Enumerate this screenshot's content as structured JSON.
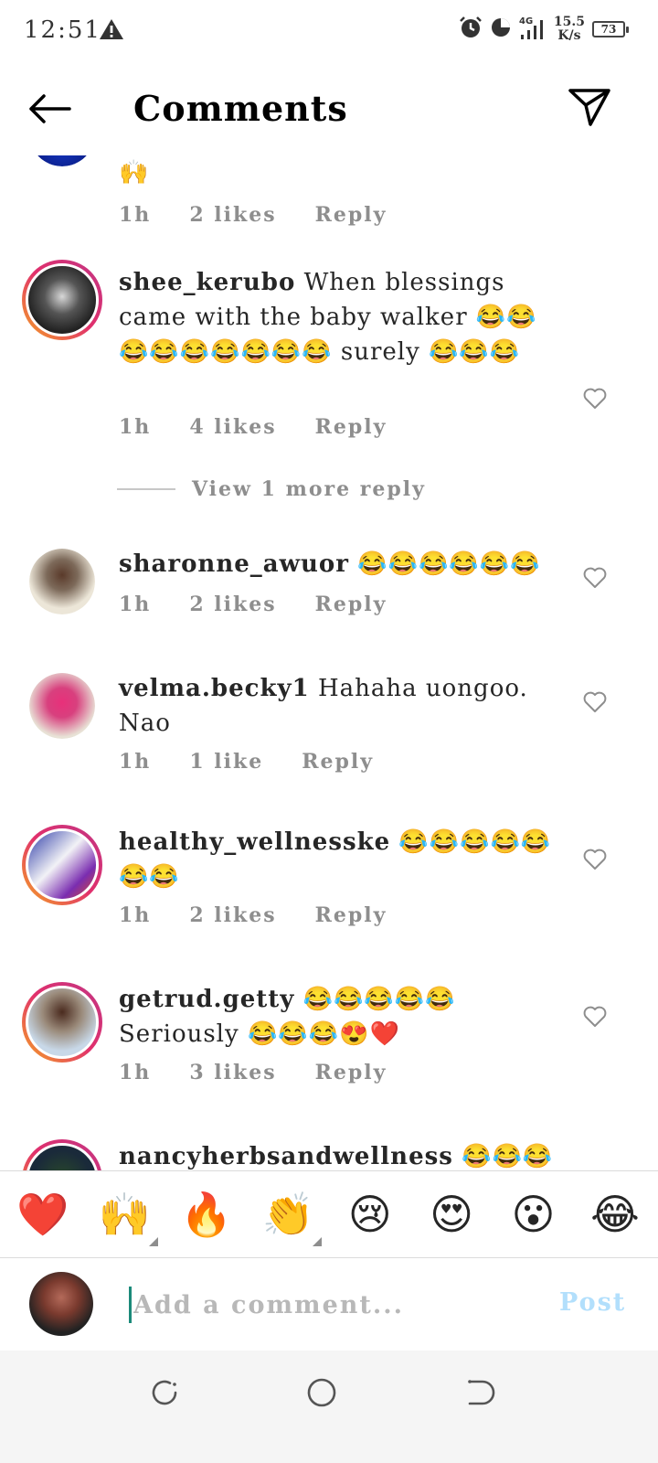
{
  "status_bar": {
    "time": "12:51",
    "network_type": "4G",
    "net_speed_value": "15.5",
    "net_speed_unit": "K/s",
    "battery": "73"
  },
  "header": {
    "title": "Comments"
  },
  "partial_comment": {
    "text": "🙌",
    "time": "1h",
    "likes": "2 likes",
    "reply": "Reply"
  },
  "comments": [
    {
      "username": "shee_kerubo",
      "text": "When blessings came with the baby walker 😂😂😂😂😂😂😂😂😂 surely 😂😂😂",
      "time": "1h",
      "likes": "4 likes",
      "reply": "Reply",
      "has_story_ring": true
    },
    {
      "username": "sharonne_awuor",
      "text": "😂😂😂😂😂😂",
      "time": "1h",
      "likes": "2 likes",
      "reply": "Reply",
      "has_story_ring": false
    },
    {
      "username": "velma.becky1",
      "text": "Hahaha uongoo. Nao",
      "time": "1h",
      "likes": "1 like",
      "reply": "Reply",
      "has_story_ring": false
    },
    {
      "username": "healthy_wellnesske",
      "text": "😂😂😂😂😂😂😂",
      "time": "1h",
      "likes": "2 likes",
      "reply": "Reply",
      "has_story_ring": true
    },
    {
      "username": "getrud.getty",
      "text": "😂😂😂😂😂 Seriously 😂😂😂😍❤️",
      "time": "1h",
      "likes": "3 likes",
      "reply": "Reply",
      "has_story_ring": true
    },
    {
      "username": "nancyherbsandwellness",
      "text": "😂😂😂",
      "has_story_ring": true
    }
  ],
  "view_more_replies": "View 1 more reply",
  "emoji_bar": [
    "❤️",
    "🙌",
    "🔥",
    "👏",
    "😢",
    "😍",
    "😮",
    "😂"
  ],
  "composer": {
    "placeholder": "Add a comment...",
    "post_label": "Post"
  },
  "colors": {
    "story_ring_start": "#f5a623",
    "story_ring_end": "#c13584",
    "meta_gray": "#8e8e8e",
    "post_disabled": "#b2dffc",
    "cursor": "#1b8a7a"
  },
  "icons": {
    "back": "arrow-left-icon",
    "share": "paper-plane-icon",
    "like": "heart-outline-icon",
    "nav_recents": "recents-icon",
    "nav_home": "home-circle-icon",
    "nav_back": "nav-back-icon"
  }
}
